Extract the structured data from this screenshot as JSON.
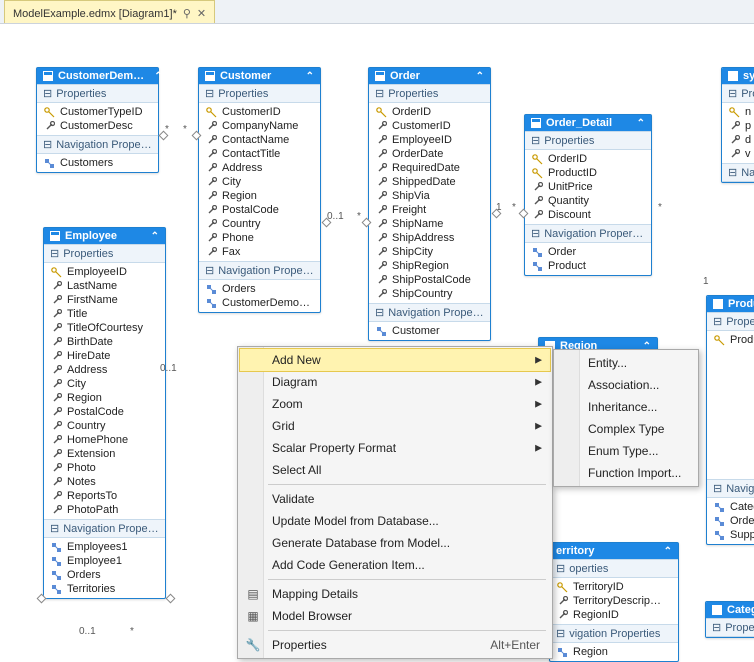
{
  "tab": {
    "title": "ModelExample.edmx [Diagram1]*"
  },
  "labels": {
    "properties": "Properties",
    "navprops": "Navigation Properties"
  },
  "cardinality": {
    "star": "*",
    "zero_one": "0..1",
    "one": "1"
  },
  "entities": {
    "customerDemo": {
      "title": "CustomerDem…",
      "props": [
        "CustomerTypeID",
        "CustomerDesc"
      ],
      "nav": [
        "Customers"
      ]
    },
    "customer": {
      "title": "Customer",
      "props": [
        "CustomerID",
        "CompanyName",
        "ContactName",
        "ContactTitle",
        "Address",
        "City",
        "Region",
        "PostalCode",
        "Country",
        "Phone",
        "Fax"
      ],
      "nav": [
        "Orders",
        "CustomerDemo…"
      ]
    },
    "order": {
      "title": "Order",
      "props": [
        "OrderID",
        "CustomerID",
        "EmployeeID",
        "OrderDate",
        "RequiredDate",
        "ShippedDate",
        "ShipVia",
        "Freight",
        "ShipName",
        "ShipAddress",
        "ShipCity",
        "ShipRegion",
        "ShipPostalCode",
        "ShipCountry"
      ],
      "nav": [
        "Customer"
      ]
    },
    "orderDetail": {
      "title": "Order_Detail",
      "props": [
        "OrderID",
        "ProductID",
        "UnitPrice",
        "Quantity",
        "Discount"
      ],
      "nav": [
        "Order",
        "Product"
      ]
    },
    "employee": {
      "title": "Employee",
      "props": [
        "EmployeeID",
        "LastName",
        "FirstName",
        "Title",
        "TitleOfCourtesy",
        "BirthDate",
        "HireDate",
        "Address",
        "City",
        "Region",
        "PostalCode",
        "Country",
        "HomePhone",
        "Extension",
        "Photo",
        "Notes",
        "ReportsTo",
        "PhotoPath"
      ],
      "nav": [
        "Employees1",
        "Employee1",
        "Orders",
        "Territories"
      ]
    },
    "region": {
      "title": "Region"
    },
    "product": {
      "title": "Product",
      "propsHeader": "Properties",
      "props": [
        "Product"
      ],
      "navHeader": "Navigatio",
      "nav": [
        "Catego",
        "Order_D",
        "Supplie"
      ]
    },
    "territory": {
      "title": "erritory",
      "propsHeader": "operties",
      "props": [
        "TerritoryID",
        "TerritoryDescrip…",
        "RegionID"
      ],
      "navHeader": "vigation Properties",
      "nav": [
        "Region"
      ]
    },
    "sys": {
      "title": "sys",
      "propsHeader": "Prop",
      "props": [
        "n",
        "p",
        "d",
        "v"
      ],
      "navHeader": "Navi"
    },
    "category": {
      "title": "Category",
      "propsHeader": "Properties"
    }
  },
  "menu": {
    "main": [
      {
        "label": "Add New",
        "sub": true,
        "hl": true
      },
      {
        "label": "Diagram",
        "sub": true
      },
      {
        "label": "Zoom",
        "sub": true
      },
      {
        "label": "Grid",
        "sub": true
      },
      {
        "label": "Scalar Property Format",
        "sub": true
      },
      {
        "label": "Select All"
      },
      {
        "sep": true
      },
      {
        "label": "Validate"
      },
      {
        "label": "Update Model from Database..."
      },
      {
        "label": "Generate Database from Model..."
      },
      {
        "label": "Add Code Generation Item..."
      },
      {
        "sep": true
      },
      {
        "label": "Mapping Details",
        "icon": "map"
      },
      {
        "label": "Model Browser",
        "icon": "browser"
      },
      {
        "sep": true
      },
      {
        "label": "Properties",
        "icon": "wrench",
        "hotkey": "Alt+Enter"
      }
    ],
    "submenu": [
      {
        "label": "Entity..."
      },
      {
        "label": "Association..."
      },
      {
        "label": "Inheritance..."
      },
      {
        "label": "Complex Type"
      },
      {
        "label": "Enum Type..."
      },
      {
        "label": "Function Import..."
      }
    ]
  }
}
